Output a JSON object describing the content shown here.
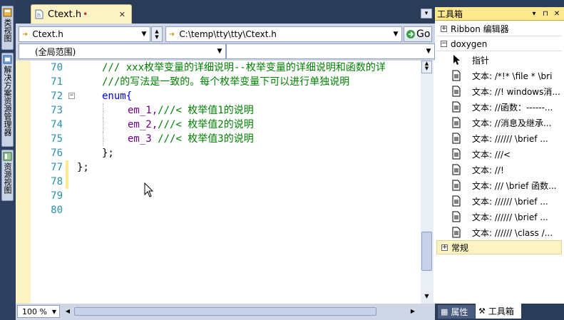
{
  "left_strip": {
    "tabs": [
      {
        "label": "类视图",
        "icon": "class-view-icon"
      },
      {
        "label": "解决方案资源管理器",
        "icon": "solution-explorer-icon"
      },
      {
        "label": "资源视图",
        "icon": "resource-view-icon"
      }
    ]
  },
  "editor": {
    "tab": {
      "label": "Ctext.h",
      "modified_marker": "•",
      "close": "✕"
    },
    "nav": {
      "file_combo": "Ctext.h",
      "path_combo": "C:\\temp\\tty\\tty\\Ctext.h",
      "go_button": "Go",
      "scope_combo": "(全局范围)"
    },
    "lines": [
      {
        "num": "70",
        "text": "/// xxx枚举变量的详细说明--枚举变量的详细说明和函数的详",
        "type": "comment"
      },
      {
        "num": "71",
        "text": "///的写法是一致的。每个枚举变量下可以进行单独说明",
        "type": "comment"
      },
      {
        "num": "72",
        "text": "enum{",
        "type": "enum"
      },
      {
        "num": "73",
        "member": "em_1,",
        "comment": "///< 枚举值1的说明"
      },
      {
        "num": "74",
        "member": "em_2,",
        "comment": "///< 枚举值2的说明"
      },
      {
        "num": "75",
        "member": "em_3 ",
        "comment": "///< 枚举值3的说明"
      },
      {
        "num": "76",
        "text": "};",
        "type": "plain"
      },
      {
        "num": "77",
        "text": "};",
        "type": "plain"
      },
      {
        "num": "78",
        "text": "",
        "type": "plain"
      },
      {
        "num": "79",
        "text": "",
        "type": "plain"
      },
      {
        "num": "80",
        "text": "",
        "type": "plain"
      }
    ],
    "zoom": "100 %"
  },
  "toolbox": {
    "title": "工具箱",
    "title_buttons": [
      "▾",
      "⊓",
      "✕"
    ],
    "groups": {
      "ribbon": "Ribbon 编辑器",
      "doxygen": "doxygen",
      "general": "常规"
    },
    "items": [
      {
        "label": "指针",
        "icon": "pointer-icon"
      },
      {
        "label": "文本: /*!* \\file * \\bri",
        "icon": "text-snippet-icon"
      },
      {
        "label": "文本: //! windows消...",
        "icon": "text-snippet-icon"
      },
      {
        "label": "文本: //函数：------...",
        "icon": "text-snippet-icon"
      },
      {
        "label": "文本: //消息及继承...",
        "icon": "text-snippet-icon"
      },
      {
        "label": "文本: ////// \\brief ...",
        "icon": "text-snippet-icon"
      },
      {
        "label": "文本: ///<",
        "icon": "text-snippet-icon"
      },
      {
        "label": "文本: //!",
        "icon": "text-snippet-icon"
      },
      {
        "label": "文本: /// \\brief 函数...",
        "icon": "text-snippet-icon"
      },
      {
        "label": "文本: ////// \\brief ...",
        "icon": "text-snippet-icon"
      },
      {
        "label": "文本: ////// \\brief ...",
        "icon": "text-snippet-icon"
      },
      {
        "label": "文本: ////// \\class /...",
        "icon": "text-snippet-icon"
      }
    ],
    "bottom_tabs": [
      "属性",
      "工具箱"
    ]
  }
}
